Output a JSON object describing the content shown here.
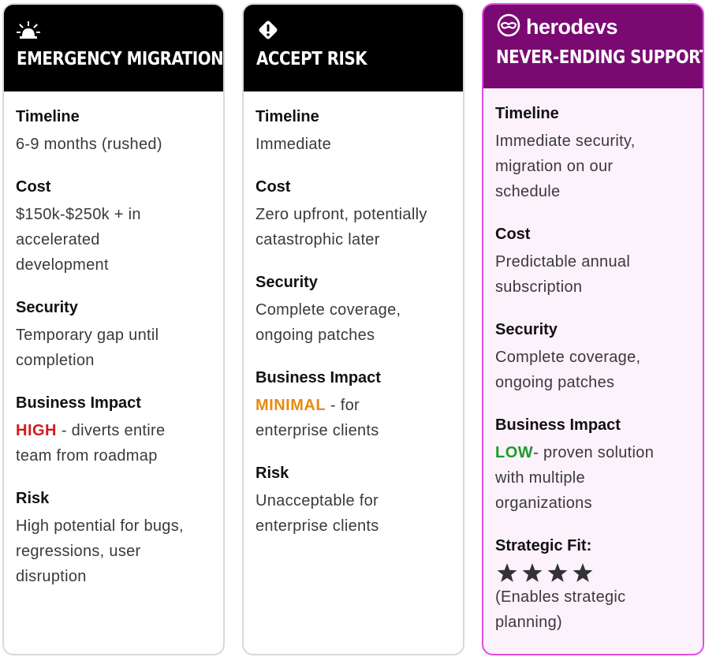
{
  "cards": [
    {
      "icon": "siren-icon",
      "title": "EMERGENCY MIGRATION",
      "sections": {
        "timeline": {
          "label": "Timeline",
          "text": "6-9 months (rushed)"
        },
        "cost": {
          "label": "Cost",
          "line1": "$150k-$250k + in",
          "line2": "accelerated",
          "line3": "development"
        },
        "security": {
          "label": "Security",
          "line1": "Temporary gap until",
          "line2": "completion"
        },
        "impact": {
          "label": "Business Impact",
          "highlight": "HIGH",
          "highlight_color": "#d21c1c",
          "line1_rest": " - diverts entire",
          "line2": "team from roadmap"
        },
        "risk": {
          "label": "Risk",
          "line1": "High potential for bugs,",
          "line2": "regressions, user",
          "line3": "disruption"
        }
      }
    },
    {
      "icon": "warning-diamond-icon",
      "title": "ACCEPT RISK",
      "sections": {
        "timeline": {
          "label": "Timeline",
          "text": "Immediate"
        },
        "cost": {
          "label": "Cost",
          "line1": "Zero upfront, potentially",
          "line2": "catastrophic later"
        },
        "security": {
          "label": "Security",
          "line1": "Complete coverage,",
          "line2": "ongoing patches"
        },
        "impact": {
          "label": "Business Impact",
          "highlight": "MINIMAL",
          "highlight_color": "#e88a12",
          "line1_rest": " - for",
          "line2": "enterprise clients"
        },
        "risk": {
          "label": "Risk",
          "line1": "Unacceptable for",
          "line2": "enterprise clients"
        }
      }
    },
    {
      "brand": "herodevs",
      "brand_icon": "herodevs-mask-logo-icon",
      "title": "NEVER-ENDING SUPPORT",
      "accent": "#7a0a72",
      "border": "#e04ee0",
      "sections": {
        "timeline": {
          "label": "Timeline",
          "line1": "Immediate security,",
          "line2": "migration on our",
          "line3": "schedule"
        },
        "cost": {
          "label": "Cost",
          "line1": "Predictable annual",
          "line2": "subscription"
        },
        "security": {
          "label": "Security",
          "line1": "Complete coverage,",
          "line2": "ongoing patches"
        },
        "impact": {
          "label": "Business Impact",
          "highlight": "LOW",
          "highlight_color": "#1e9a2a",
          "line1_rest": "- proven solution",
          "line2": "with multiple",
          "line3": "organizations"
        },
        "fit": {
          "label": "Strategic Fit:",
          "rating": 4,
          "line1": "(Enables strategic",
          "line2": "planning)"
        }
      }
    }
  ]
}
